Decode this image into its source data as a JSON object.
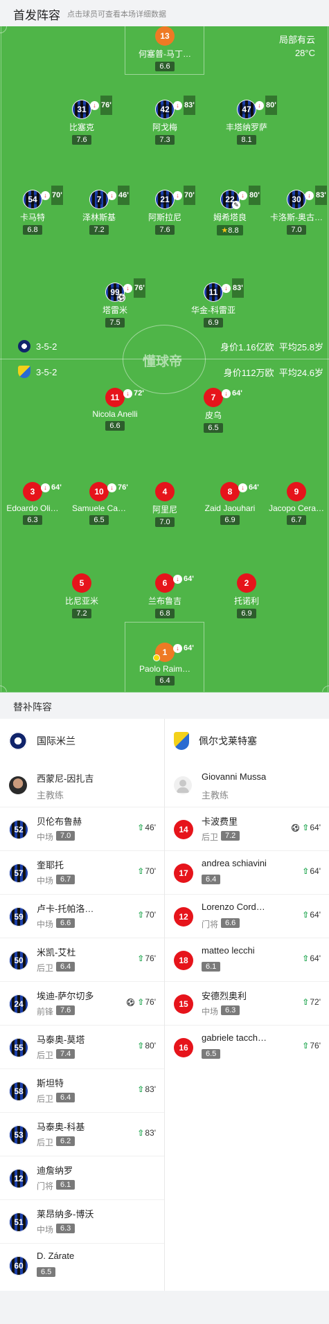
{
  "header": {
    "title": "首发阵容",
    "subtitle": "点击球员可查看本场详细数据"
  },
  "weather": {
    "condition": "局部有云",
    "temp": "28°C"
  },
  "watermark": "懂球帝",
  "home_formation": {
    "shape": "3-5-2",
    "value": "身价1.16亿欧",
    "age": "平均25.8岁"
  },
  "away_formation": {
    "shape": "3-5-2",
    "value": "身价112万欧",
    "age": "平均24.6岁"
  },
  "players": {
    "p1": {
      "num": "13",
      "name": "何塞普-马丁…",
      "rating": "6.6"
    },
    "p2": {
      "num": "31",
      "name": "比塞克",
      "rating": "7.6",
      "sub": "76'"
    },
    "p3": {
      "num": "42",
      "name": "阿戈梅",
      "rating": "7.3",
      "sub": "83'"
    },
    "p4": {
      "num": "47",
      "name": "丰塔纳罗萨",
      "rating": "8.1",
      "sub": "80'"
    },
    "p5": {
      "num": "54",
      "name": "卡马特",
      "rating": "6.8",
      "sub": "70'"
    },
    "p6": {
      "num": "7",
      "name": "泽林斯基",
      "rating": "7.2",
      "sub": "46'"
    },
    "p7": {
      "num": "21",
      "name": "阿斯拉尼",
      "rating": "7.6",
      "sub": "70'"
    },
    "p8": {
      "num": "22",
      "name": "姆希塔良",
      "rating": "8.8",
      "sub": "80'"
    },
    "p9": {
      "num": "30",
      "name": "卡洛斯-奥古…",
      "rating": "7.0",
      "sub": "83'"
    },
    "p10": {
      "num": "99",
      "name": "塔雷米",
      "rating": "7.5",
      "sub": "76'"
    },
    "p11": {
      "num": "11",
      "name": "华金-科雷亚",
      "rating": "6.9",
      "sub": "83'"
    },
    "a1": {
      "num": "11",
      "name": "Nicola Anelli",
      "rating": "6.6",
      "sub": "72'"
    },
    "a2": {
      "num": "7",
      "name": "皮乌",
      "rating": "6.5",
      "sub": "64'"
    },
    "a3": {
      "num": "3",
      "name": "Edoardo Oli…",
      "rating": "6.3",
      "sub": "64'"
    },
    "a4": {
      "num": "10",
      "name": "Samuele Ca…",
      "rating": "6.5",
      "sub": "76'"
    },
    "a5": {
      "num": "4",
      "name": "阿里尼",
      "rating": "7.0"
    },
    "a6": {
      "num": "8",
      "name": "Zaid Jaouhari",
      "rating": "6.9",
      "sub": "64'"
    },
    "a7": {
      "num": "9",
      "name": "Jacopo Cera…",
      "rating": "6.7"
    },
    "a8": {
      "num": "5",
      "name": "比尼亚米",
      "rating": "7.2"
    },
    "a9": {
      "num": "6",
      "name": "兰布鲁吉",
      "rating": "6.8",
      "sub": "64'"
    },
    "a10": {
      "num": "2",
      "name": "托诺利",
      "rating": "6.9"
    },
    "a11": {
      "num": "1",
      "name": "Paolo Raim…",
      "rating": "6.4",
      "sub": "64'"
    }
  },
  "subs_title": "替补阵容",
  "home": {
    "team": "国际米兰",
    "coach": "西蒙尼-因扎吉",
    "coach_label": "主教练",
    "subs": [
      {
        "num": "52",
        "name": "贝伦布鲁赫",
        "pos": "中场",
        "rating": "7.0",
        "time": "46'"
      },
      {
        "num": "57",
        "name": "奎耶托",
        "pos": "中场",
        "rating": "6.7",
        "time": "70'"
      },
      {
        "num": "59",
        "name": "卢卡-托帕洛…",
        "pos": "中场",
        "rating": "6.6",
        "time": "70'"
      },
      {
        "num": "50",
        "name": "米凯-艾杜",
        "pos": "后卫",
        "rating": "6.4",
        "time": "76'"
      },
      {
        "num": "24",
        "name": "埃迪-萨尔切多",
        "pos": "前锋",
        "rating": "7.6",
        "time": "76'"
      },
      {
        "num": "55",
        "name": "马泰奥-莫塔",
        "pos": "后卫",
        "rating": "7.4",
        "time": "80'"
      },
      {
        "num": "58",
        "name": "斯坦特",
        "pos": "后卫",
        "rating": "6.4",
        "time": "83'"
      },
      {
        "num": "53",
        "name": "马泰奥-科基",
        "pos": "后卫",
        "rating": "6.2",
        "time": "83'"
      },
      {
        "num": "12",
        "name": "迪詹纳罗",
        "pos": "门将",
        "rating": "6.1",
        "time": ""
      },
      {
        "num": "51",
        "name": "莱昂纳多-博沃",
        "pos": "中场",
        "rating": "6.3",
        "time": ""
      },
      {
        "num": "60",
        "name": "D. Zárate",
        "pos": "",
        "rating": "6.5",
        "time": ""
      }
    ]
  },
  "away": {
    "team": "佩尔戈莱特塞",
    "coach": "Giovanni Mussa",
    "coach_label": "主教练",
    "subs": [
      {
        "num": "14",
        "name": "卡波费里",
        "pos": "后卫",
        "rating": "7.2",
        "time": "64'"
      },
      {
        "num": "17",
        "name": "andrea schiavini",
        "pos": "",
        "rating": "6.4",
        "time": "64'"
      },
      {
        "num": "12",
        "name": "Lorenzo Cord…",
        "pos": "门将",
        "rating": "6.6",
        "time": "64'"
      },
      {
        "num": "18",
        "name": "matteo lecchi",
        "pos": "",
        "rating": "6.1",
        "time": "64'"
      },
      {
        "num": "15",
        "name": "安德烈奥利",
        "pos": "中场",
        "rating": "6.3",
        "time": "72'"
      },
      {
        "num": "16",
        "name": "gabriele tacch…",
        "pos": "",
        "rating": "6.5",
        "time": "76'"
      }
    ]
  }
}
